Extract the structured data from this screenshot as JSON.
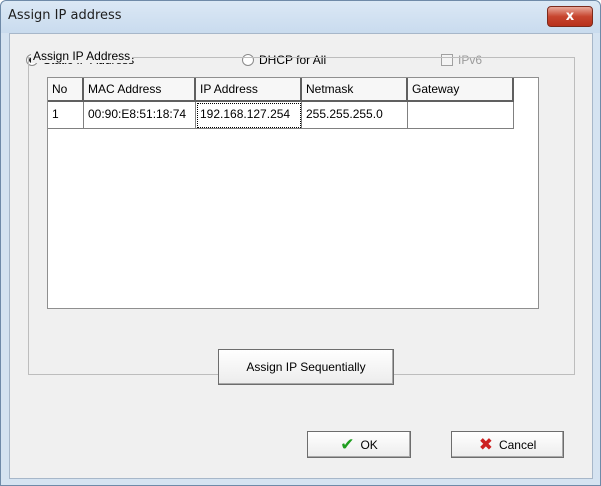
{
  "window": {
    "title": "Assign IP address",
    "close_glyph": "x"
  },
  "mode": {
    "static_label": "Static IP Address",
    "dhcp_label": "DHCP for All",
    "ipv6_label": "IPv6",
    "selected": "static"
  },
  "group": {
    "label": "Assign IP Address"
  },
  "table": {
    "columns": [
      "No",
      "MAC Address",
      "IP Address",
      "Netmask",
      "Gateway"
    ],
    "rows": [
      {
        "no": "1",
        "mac": "00:90:E8:51:18:74",
        "ip": "192.168.127.254",
        "netmask": "255.255.255.0",
        "gateway": ""
      }
    ]
  },
  "buttons": {
    "assign_seq": "Assign IP Sequentially",
    "ok": "OK",
    "cancel": "Cancel"
  },
  "icons": {
    "ok": "checkmark-icon",
    "cancel": "red-x-icon"
  },
  "colors": {
    "ok_icon": "#1f9e1f",
    "cancel_icon": "#cc1f1f",
    "close_button": "#c7452f"
  }
}
